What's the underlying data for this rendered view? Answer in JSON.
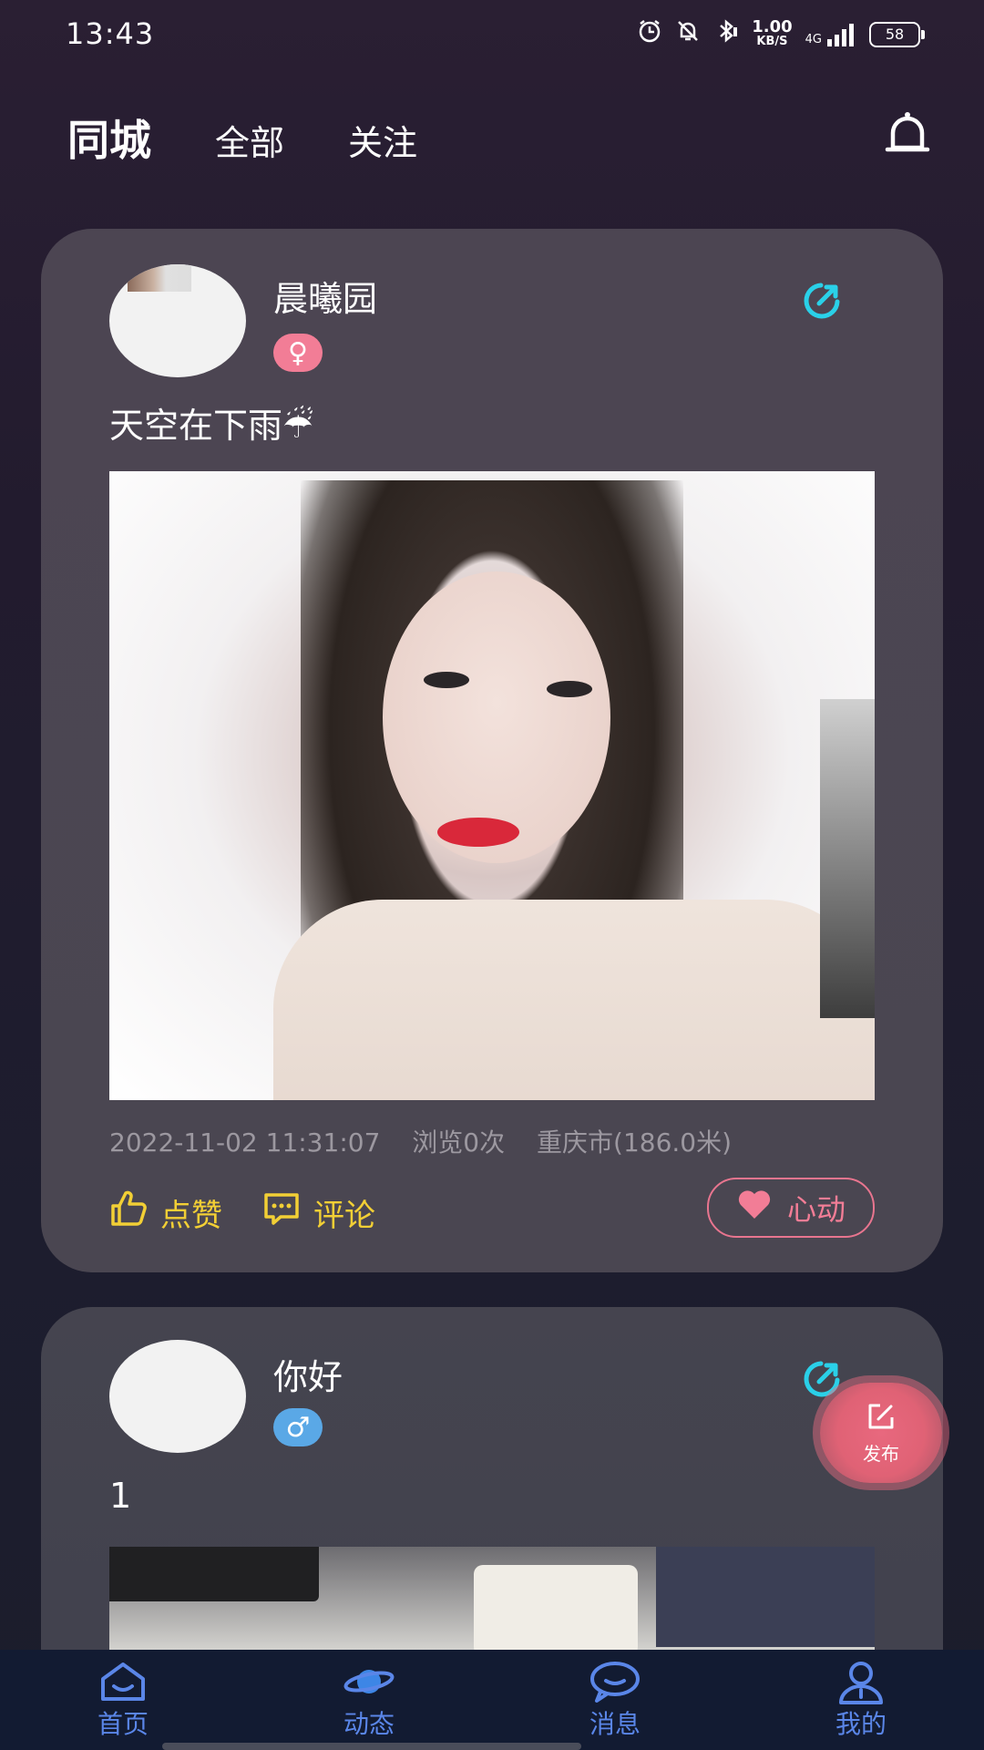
{
  "status_bar": {
    "time": "13:43",
    "net_speed_value": "1.00",
    "net_speed_unit": "KB/S",
    "network": "4G",
    "battery": "58"
  },
  "tabs": {
    "active": "同城",
    "items": [
      "全部",
      "关注"
    ]
  },
  "posts": [
    {
      "username": "晨曦园",
      "gender_symbol": "♀",
      "text": "天空在下雨☔",
      "timestamp": "2022-11-02 11:31:07",
      "views": "浏览0次",
      "location": "重庆市(186.0米)",
      "like_label": "点赞",
      "comment_label": "评论",
      "heart_label": "心动"
    },
    {
      "username": "你好",
      "gender_symbol": "♂",
      "text": "1"
    }
  ],
  "fab": {
    "label": "发布"
  },
  "bottom_nav": [
    {
      "label": "首页",
      "icon": "home-icon"
    },
    {
      "label": "动态",
      "icon": "planet-icon"
    },
    {
      "label": "消息",
      "icon": "chat-icon"
    },
    {
      "label": "我的",
      "icon": "user-icon"
    }
  ],
  "colors": {
    "accent_yellow": "#f2cf35",
    "accent_pink": "#f27d96",
    "nav_blue": "#5a86e8",
    "share_cyan": "#2ad0e8"
  }
}
